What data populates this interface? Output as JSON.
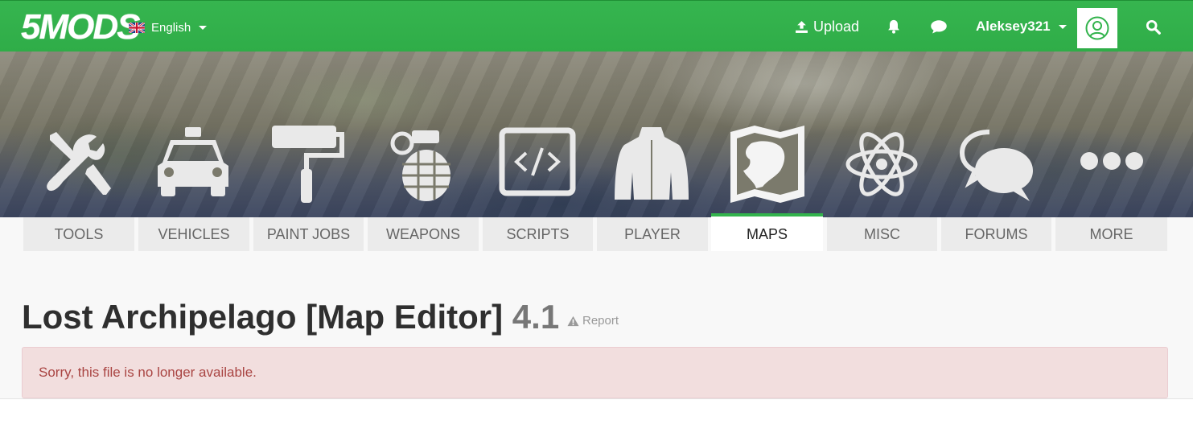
{
  "navbar": {
    "logo_text": "5MODS",
    "language": "English",
    "upload_label": "Upload",
    "username": "Aleksey321",
    "brand_color": "#32b34c"
  },
  "hero": {
    "icons": [
      "wrench-screwdriver-icon",
      "car-icon",
      "paint-roller-icon",
      "grenade-icon",
      "code-icon",
      "jacket-icon",
      "map-icon",
      "atom-icon",
      "speech-bubbles-icon",
      "ellipsis-icon"
    ]
  },
  "tabs": [
    {
      "label": "TOOLS"
    },
    {
      "label": "VEHICLES"
    },
    {
      "label": "PAINT JOBS"
    },
    {
      "label": "WEAPONS"
    },
    {
      "label": "SCRIPTS"
    },
    {
      "label": "PLAYER"
    },
    {
      "label": "MAPS",
      "active": true
    },
    {
      "label": "MISC"
    },
    {
      "label": "FORUMS"
    },
    {
      "label": "MORE"
    }
  ],
  "page": {
    "title": "Lost Archipelago [Map Editor]",
    "version": "4.1",
    "report_label": "Report",
    "alert_text": "Sorry, this file is no longer available."
  }
}
